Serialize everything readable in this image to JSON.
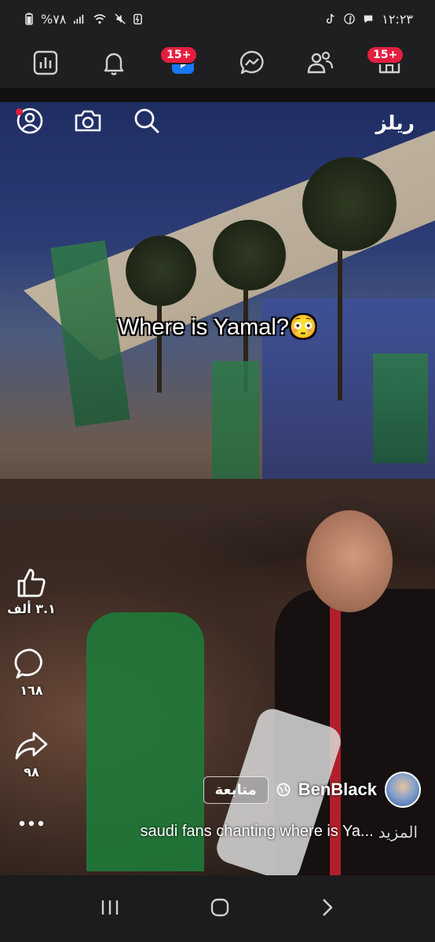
{
  "status_bar": {
    "time": "١٢:٢٣",
    "battery": "%٧٨"
  },
  "top_nav": {
    "items": [
      {
        "name": "insights",
        "icon": "bar-chart-icon"
      },
      {
        "name": "notifications",
        "icon": "bell-icon"
      },
      {
        "name": "video",
        "icon": "video-icon",
        "badge": "15+"
      },
      {
        "name": "messenger",
        "icon": "messenger-icon"
      },
      {
        "name": "friends",
        "icon": "friends-icon"
      },
      {
        "name": "home",
        "icon": "home-icon",
        "badge": "15+"
      }
    ]
  },
  "reel": {
    "header_title": "ريلز",
    "overlay_text": "Where is Yamal?😳",
    "actions": {
      "likes": "٣.١ ألف",
      "comments": "١٦٨",
      "shares": "٩٨"
    },
    "author": {
      "name": "BenBlack",
      "follow_label": "متابعة"
    },
    "description": "saudi fans chanting where is Ya...",
    "more_label": "المزيد"
  },
  "colors": {
    "accent_red": "#e41e3f",
    "messenger_blue": "#1877f2"
  }
}
